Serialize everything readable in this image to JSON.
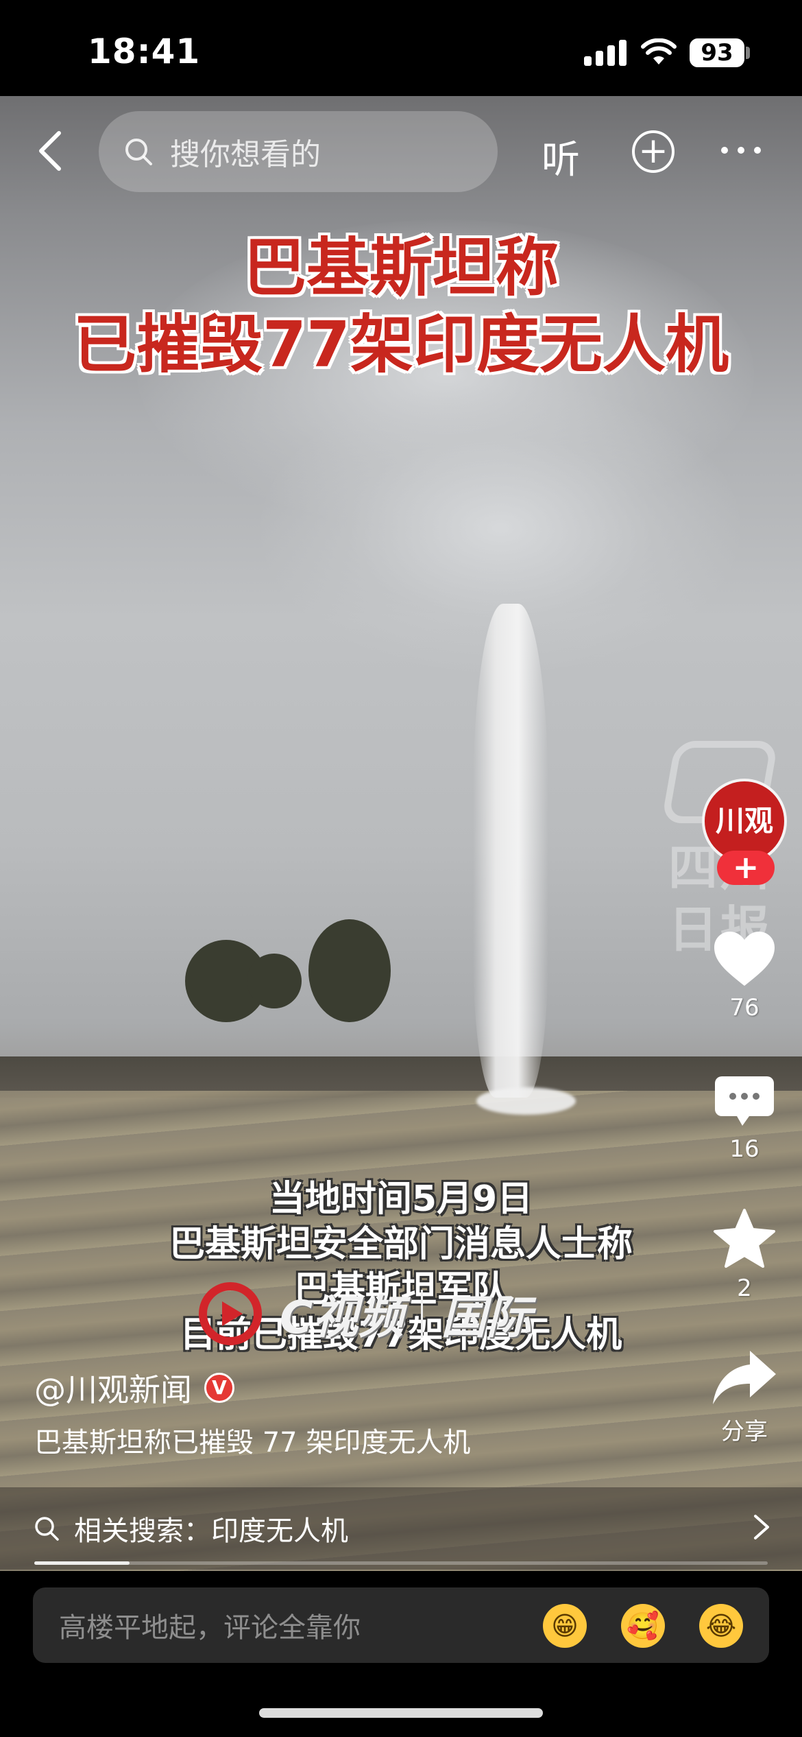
{
  "status_bar": {
    "time": "18:41",
    "battery": "93"
  },
  "top_nav": {
    "search_placeholder": "搜你想看的",
    "listen_label": "听"
  },
  "video": {
    "headline_line1": "巴基斯坦称",
    "headline_line2": "已摧毁77架印度无人机",
    "captions": [
      "当地时间5月9日",
      "巴基斯坦安全部门消息人士称",
      "巴基斯坦军队",
      "目前已摧毁77架印度无人机"
    ],
    "brand_name": "C视频",
    "brand_section": "国际",
    "watermark_text": "四川日报"
  },
  "actions": {
    "avatar_text": "川观",
    "likes": "76",
    "comments": "16",
    "favorites": "2",
    "share_label": "分享"
  },
  "post": {
    "author": "@川观新闻",
    "verified_badge": "V",
    "title": "巴基斯坦称已摧毁 77 架印度无人机"
  },
  "related_search": {
    "label": "相关搜索：印度无人机"
  },
  "playback": {
    "progress_fraction": 0.13
  },
  "comment_bar": {
    "placeholder": "高楼平地起，评论全靠你",
    "emojis": [
      "grinning-face",
      "hugging-face",
      "laughing-face"
    ]
  },
  "colors": {
    "headline_red": "#c8271e",
    "avatar_red": "#c41f1f",
    "follow_red": "#f0303a"
  }
}
